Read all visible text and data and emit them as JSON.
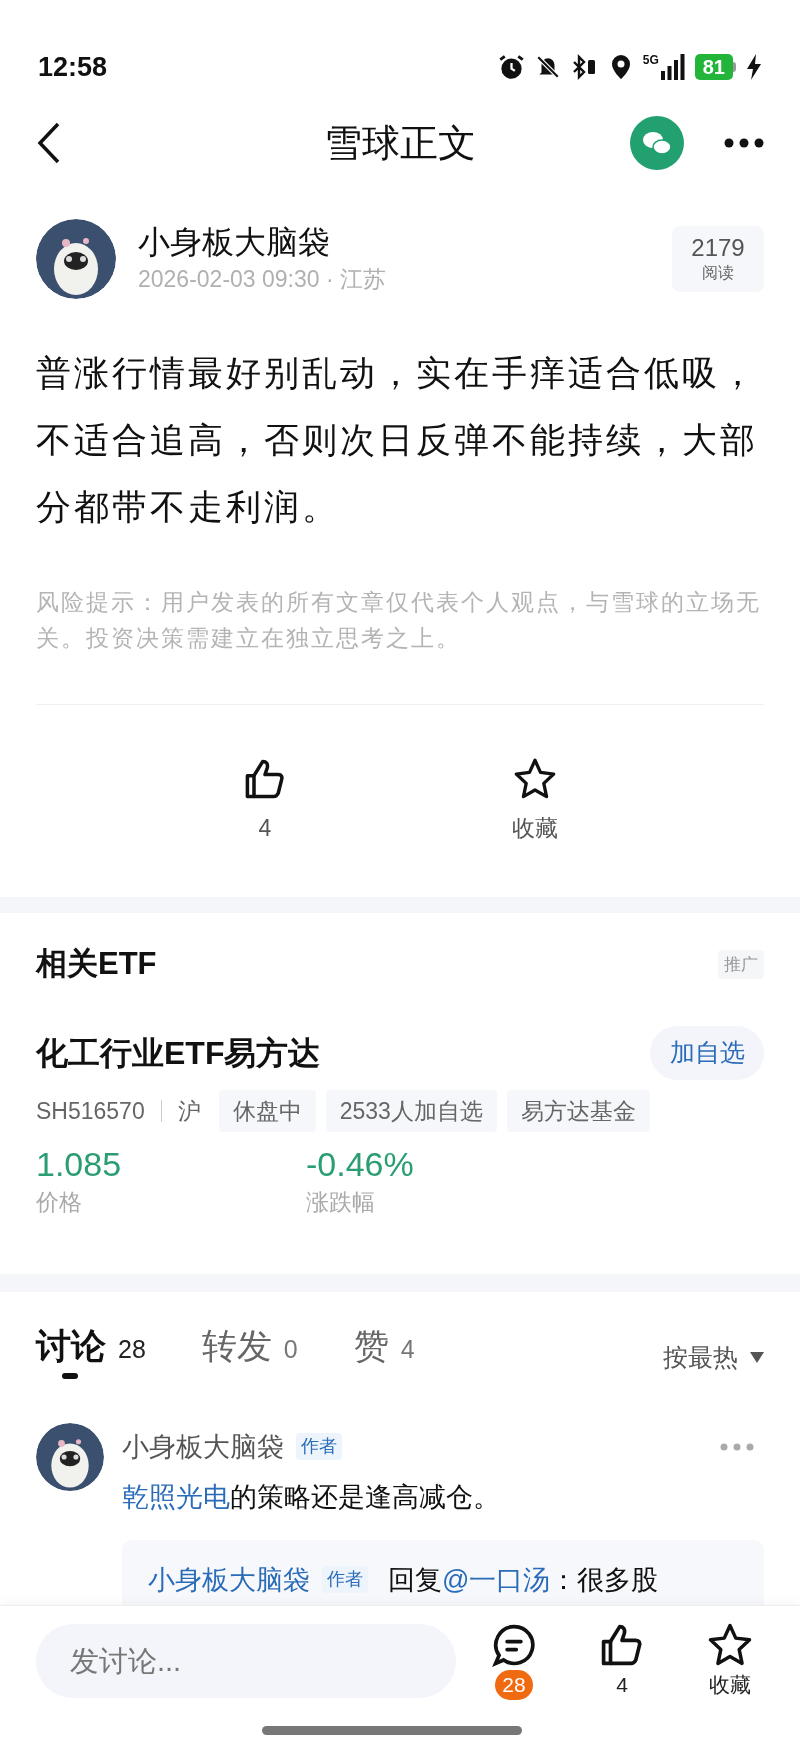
{
  "status_bar": {
    "time": "12:58",
    "network": "5G",
    "battery": "81"
  },
  "header": {
    "title": "雪球正文"
  },
  "post": {
    "author": "小身板大脑袋",
    "meta": "2026-02-03 09:30 · 江苏",
    "reads": {
      "count": "2179",
      "label": "阅读"
    },
    "body": "普涨行情最好别乱动，实在手痒适合低吸，不适合追高，否则次日反弹不能持续，大部分都带不走利润。",
    "disclaimer": "风险提示：用户发表的所有文章仅代表个人观点，与雪球的立场无关。投资决策需建立在独立思考之上。",
    "actions": [
      {
        "kind": "like",
        "label": "4"
      },
      {
        "kind": "favorite",
        "label": "收藏"
      }
    ]
  },
  "related": {
    "title": "相关ETF",
    "ad_tag": "推广",
    "fund": {
      "name": "化工行业ETF易方达",
      "add_button": "加自选",
      "code": "SH516570",
      "market": "沪",
      "tags": [
        "休盘中",
        "2533人加自选",
        "易方达基金"
      ],
      "stats": [
        {
          "value": "1.085",
          "label": "价格"
        },
        {
          "value": "-0.46%",
          "label": "涨跌幅"
        }
      ]
    }
  },
  "discussion": {
    "tabs": [
      {
        "label": "讨论",
        "count": "28",
        "selected": true
      },
      {
        "label": "转发",
        "count": "0",
        "selected": false
      },
      {
        "label": "赞",
        "count": "4",
        "selected": false
      }
    ],
    "sort": "按最热",
    "comments": [
      {
        "author": "小身板大脑袋",
        "badge": "作者",
        "link": "乾照光电",
        "text": "的策略还是逢高减仓。",
        "reply": {
          "author": "小身板大脑袋",
          "badge": "作者",
          "prefix": "回复",
          "mention": "@一口汤",
          "text": "：很多股"
        }
      }
    ]
  },
  "bottom_bar": {
    "placeholder": "发讨论...",
    "actions": [
      {
        "kind": "comment",
        "badge": "28"
      },
      {
        "kind": "like",
        "label": "4"
      },
      {
        "kind": "favorite",
        "label": "收藏"
      }
    ]
  }
}
